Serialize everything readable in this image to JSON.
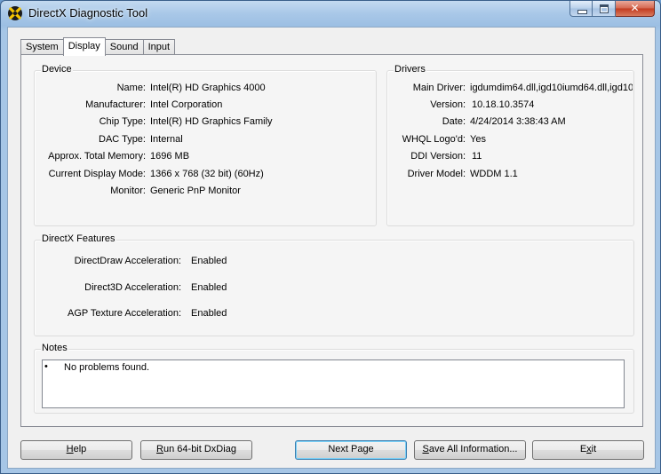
{
  "window": {
    "title": "DirectX Diagnostic Tool"
  },
  "tabs": [
    {
      "label": "System"
    },
    {
      "label": "Display"
    },
    {
      "label": "Sound"
    },
    {
      "label": "Input"
    }
  ],
  "active_tab": "Display",
  "device": {
    "title": "Device",
    "rows": [
      {
        "label": "Name:",
        "value": "Intel(R) HD Graphics 4000"
      },
      {
        "label": "Manufacturer:",
        "value": "Intel Corporation"
      },
      {
        "label": "Chip Type:",
        "value": "Intel(R) HD Graphics Family"
      },
      {
        "label": "DAC Type:",
        "value": "Internal"
      },
      {
        "label": "Approx. Total Memory:",
        "value": "1696 MB"
      },
      {
        "label": "Current Display Mode:",
        "value": "1366 x 768 (32 bit) (60Hz)"
      },
      {
        "label": "Monitor:",
        "value": "Generic PnP Monitor"
      }
    ]
  },
  "drivers": {
    "title": "Drivers",
    "rows": [
      {
        "label": "Main Driver:",
        "value": "igdumdim64.dll,igd10iumd64.dll,igd10"
      },
      {
        "label": "Version:",
        "value": "10.18.10.3574"
      },
      {
        "label": "Date:",
        "value": "4/24/2014 3:38:43 AM"
      },
      {
        "label": "WHQL Logo'd:",
        "value": "Yes"
      },
      {
        "label": "DDI Version:",
        "value": "11"
      },
      {
        "label": "Driver Model:",
        "value": "WDDM 1.1"
      }
    ]
  },
  "features": {
    "title": "DirectX Features",
    "rows": [
      {
        "label": "DirectDraw Acceleration:",
        "value": "Enabled"
      },
      {
        "label": "Direct3D Acceleration:",
        "value": "Enabled"
      },
      {
        "label": "AGP Texture Acceleration:",
        "value": "Enabled"
      }
    ]
  },
  "notes": {
    "title": "Notes",
    "bullet": "•",
    "items": [
      "No problems found."
    ]
  },
  "buttons": {
    "help": {
      "pre": "",
      "key": "H",
      "post": "elp"
    },
    "run64": {
      "pre": "",
      "key": "R",
      "post": "un 64-bit DxDiag"
    },
    "next": {
      "label": "Next Page"
    },
    "save": {
      "pre": "",
      "key": "S",
      "post": "ave All Information..."
    },
    "exit": {
      "pre": "E",
      "key": "x",
      "post": "it"
    }
  },
  "colors": {
    "titlebar": "#a9c8e8",
    "close_button": "#c23a1f",
    "dialog_bg": "#f0f0f0",
    "default_button_border": "#3c7fb1"
  }
}
